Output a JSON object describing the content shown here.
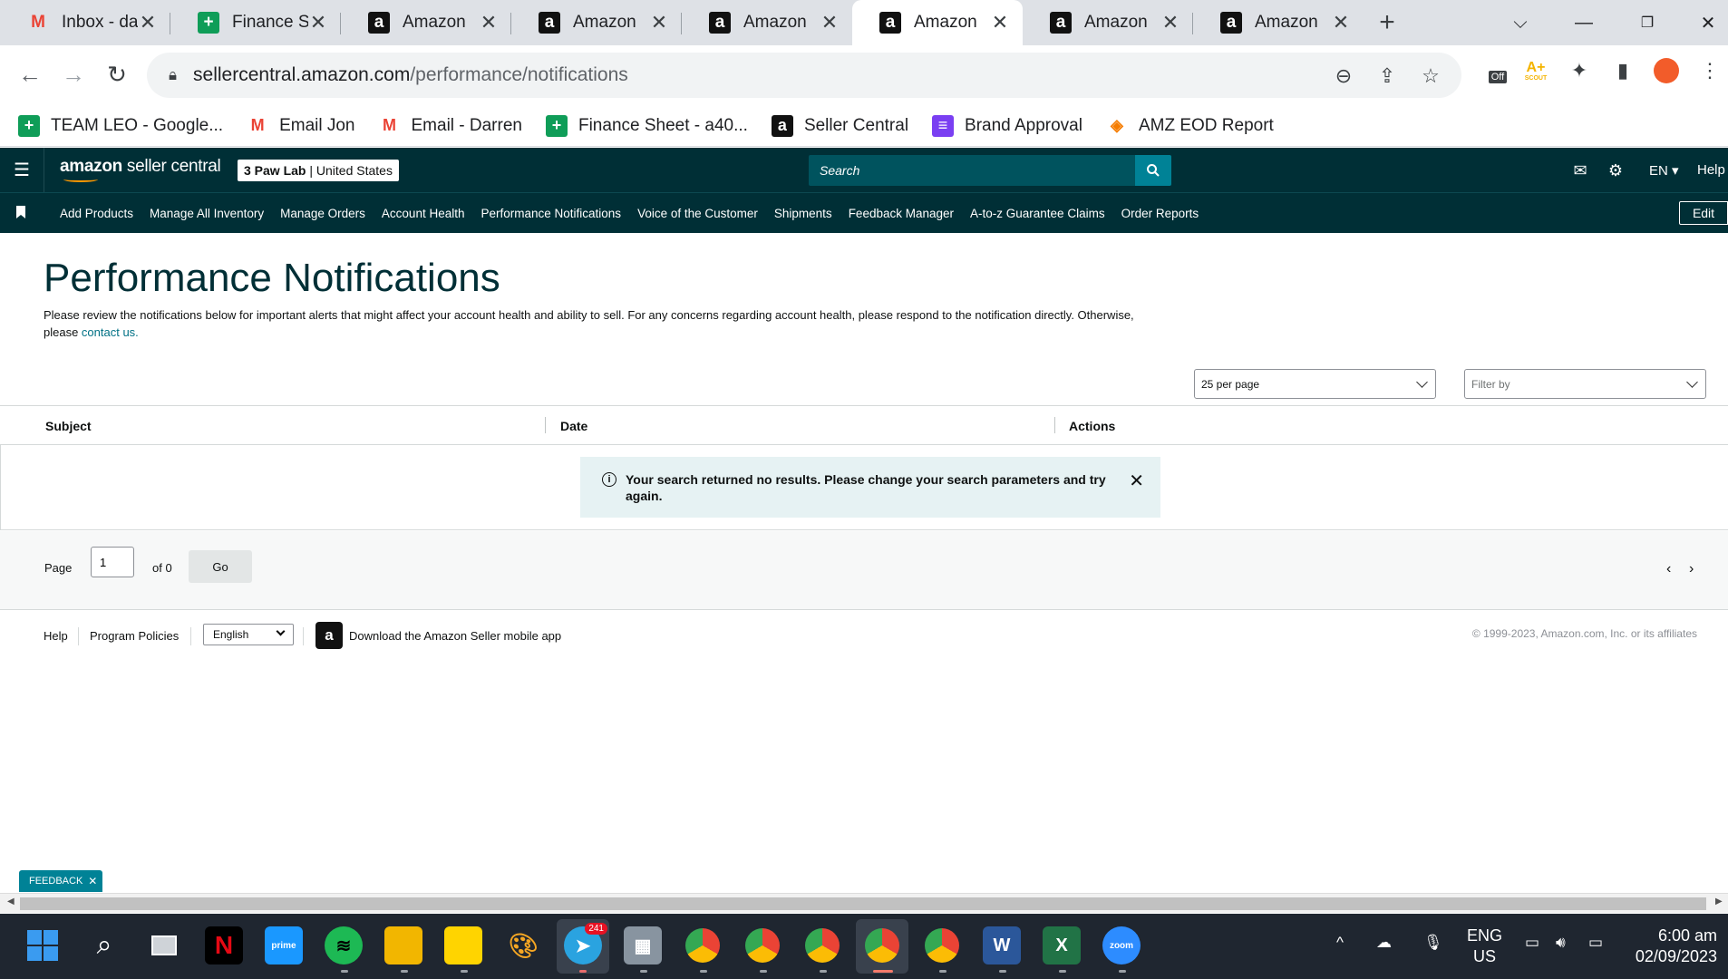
{
  "browser": {
    "tabs": [
      {
        "icon": "gmail-icon",
        "title": "Inbox - darr"
      },
      {
        "icon": "sheets-icon",
        "title": "Finance She"
      },
      {
        "icon": "amazon-icon",
        "title": "Amazon"
      },
      {
        "icon": "amazon-icon",
        "title": "Amazon"
      },
      {
        "icon": "amazon-icon",
        "title": "Amazon"
      },
      {
        "icon": "amazon-icon",
        "title": "Amazon",
        "active": true
      },
      {
        "icon": "amazon-icon",
        "title": "Amazon"
      },
      {
        "icon": "amazon-icon",
        "title": "Amazon"
      }
    ],
    "url_host": "sellercentral.amazon.com",
    "url_path": "/performance/notifications",
    "extension_badge": "Off",
    "extension_scout": "SCOUT",
    "bookmarks": [
      {
        "icon": "sheets-icon",
        "label": "TEAM LEO - Google..."
      },
      {
        "icon": "gmail-icon",
        "label": "Email Jon"
      },
      {
        "icon": "gmail-icon",
        "label": "Email - Darren"
      },
      {
        "icon": "sheets-icon",
        "label": "Finance Sheet - a40..."
      },
      {
        "icon": "amazon-icon",
        "label": "Seller Central"
      },
      {
        "icon": "form-icon",
        "label": "Brand Approval"
      },
      {
        "icon": "report-icon",
        "label": "AMZ EOD Report"
      }
    ]
  },
  "header": {
    "logo_bold": "amazon",
    "logo_rest": " seller central",
    "store_name": "3 Paw Lab",
    "store_region": "United States",
    "search_placeholder": "Search",
    "language": "EN",
    "help": "Help"
  },
  "nav": {
    "items": [
      "Add Products",
      "Manage All Inventory",
      "Manage Orders",
      "Account Health",
      "Performance Notifications",
      "Voice of the Customer",
      "Shipments",
      "Feedback Manager",
      "A-to-z Guarantee Claims",
      "Order Reports"
    ],
    "edit": "Edit"
  },
  "page": {
    "title": "Performance Notifications",
    "intro": "Please review the notifications below for important alerts that might affect your account health and ability to sell. For any concerns regarding account health, please respond to the notification directly. Otherwise, please ",
    "intro_link": "contact us.",
    "per_page": "25 per page",
    "filter_placeholder": "Filter by",
    "columns": {
      "subject": "Subject",
      "date": "Date",
      "actions": "Actions"
    },
    "alert_message": "Your search returned no results. Please change your search parameters and try again.",
    "pager": {
      "page_label": "Page",
      "current_page": "1",
      "of_label": "of 0",
      "go": "Go"
    }
  },
  "footer": {
    "help": "Help",
    "program_policies": "Program Policies",
    "language": "English",
    "download_app": "Download the Amazon Seller mobile app",
    "copyright": "© 1999-2023, Amazon.com, Inc. or its affiliates"
  },
  "feedback": "FEEDBACK",
  "taskbar": {
    "telegram_badge": "241",
    "zoom_label": "zoom",
    "language_line1": "ENG",
    "language_line2": "US",
    "time": "6:00 am",
    "date": "02/09/2023"
  },
  "colors": {
    "header_bg": "#002f36",
    "search_btn": "#008296",
    "link": "#007185",
    "alert_bg": "#e6f2f3"
  }
}
